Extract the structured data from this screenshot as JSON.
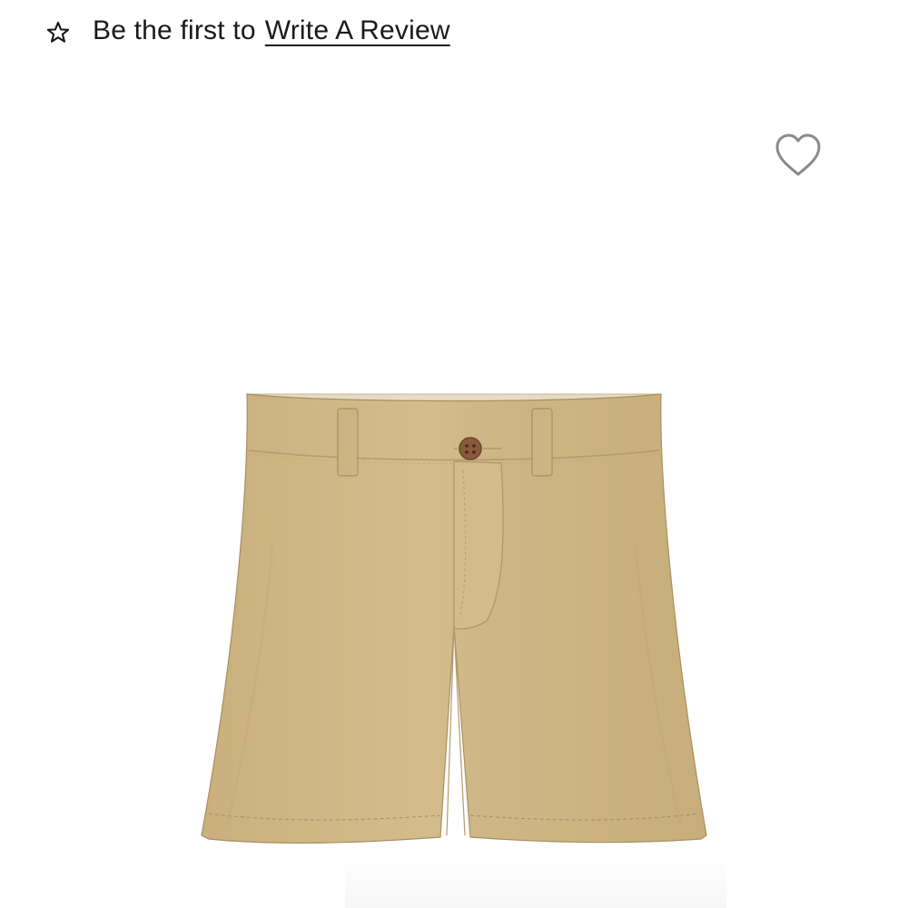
{
  "reviews": {
    "prompt": "Be the first to",
    "link_label": "Write A Review",
    "icon": "star-outline-icon"
  },
  "favorite": {
    "icon": "heart-outline-icon"
  },
  "product": {
    "image_subject": "khaki-shorts-image",
    "colors": {
      "fabric": "#d1b98a",
      "fabric_shadow": "#b89f6e",
      "waistband_inner": "#e6dcc6",
      "button": "#8a5a3c",
      "outline": "#9d8556"
    }
  }
}
